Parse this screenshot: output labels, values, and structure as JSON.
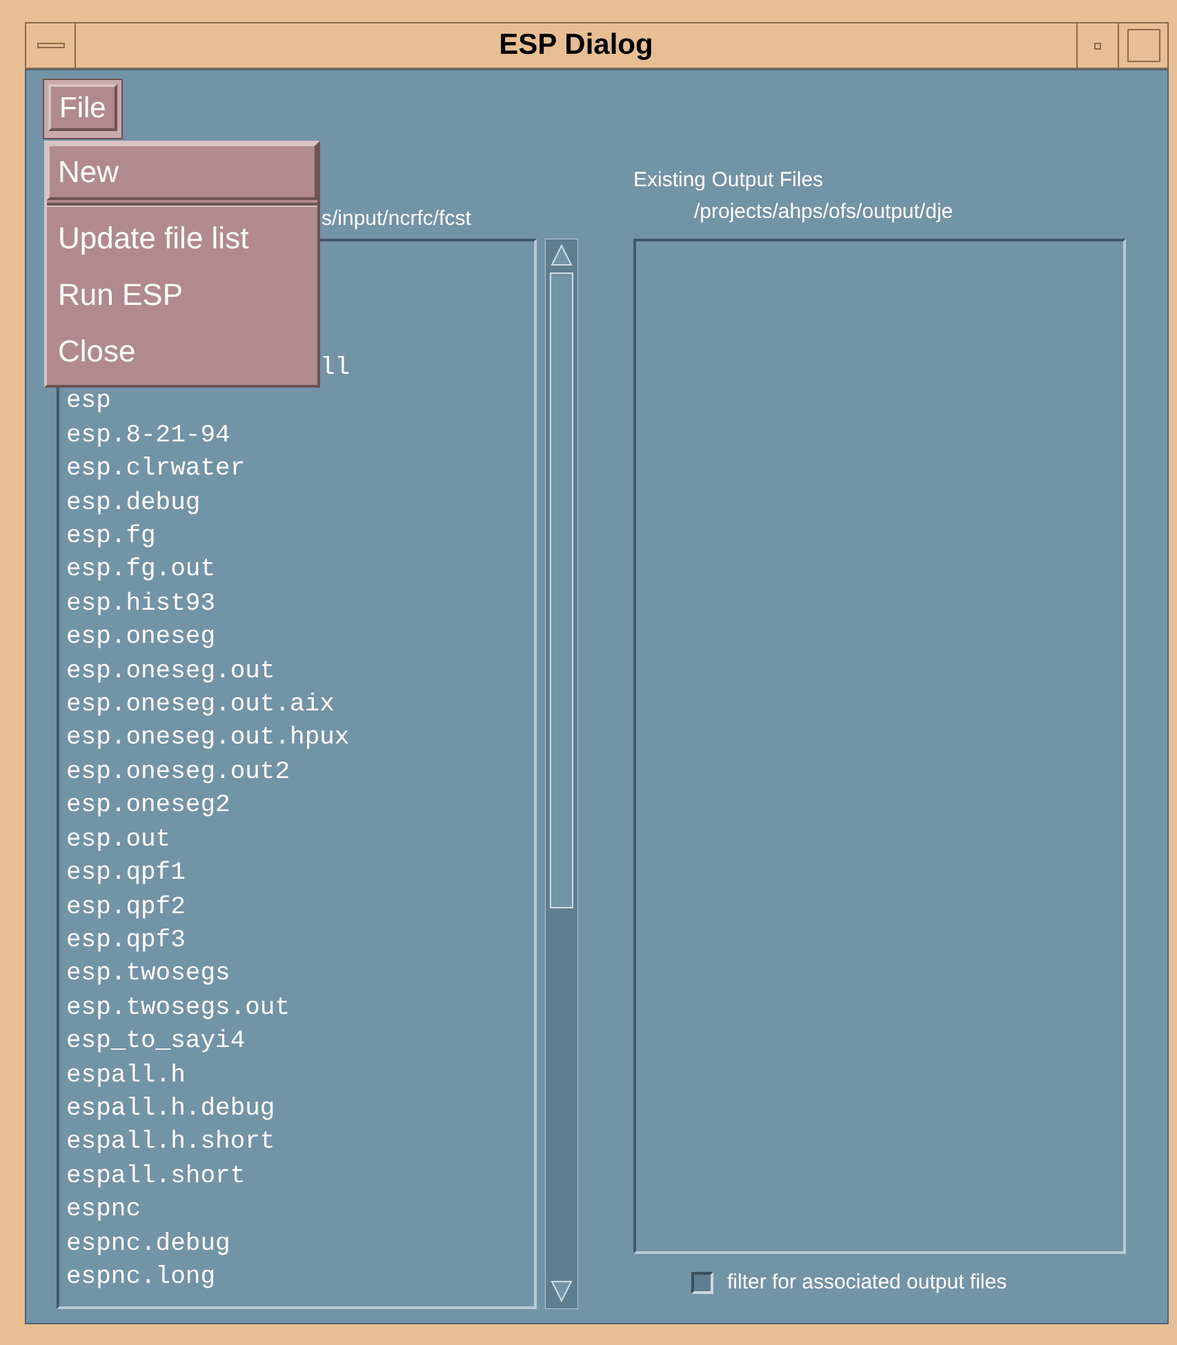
{
  "window": {
    "title": "ESP Dialog"
  },
  "menu_bar": [
    {
      "label": "File",
      "selected": true
    }
  ],
  "open_menu": {
    "items": [
      {
        "label": "New",
        "selected": true,
        "separator_after": true
      },
      {
        "label": "Update file list",
        "selected": false,
        "separator_after": false
      },
      {
        "label": "Run ESP",
        "selected": false,
        "separator_after": false
      },
      {
        "label": "Close",
        "selected": false,
        "separator_after": false
      }
    ]
  },
  "input_panel": {
    "path_fragment": "s/input/ncrfc/fcst",
    "obscured_item_fragment": "ll",
    "files": [
      "esp",
      "esp.8-21-94",
      "esp.clrwater",
      "esp.debug",
      "esp.fg",
      "esp.fg.out",
      "esp.hist93",
      "esp.oneseg",
      "esp.oneseg.out",
      "esp.oneseg.out.aix",
      "esp.oneseg.out.hpux",
      "esp.oneseg.out2",
      "esp.oneseg2",
      "esp.out",
      "esp.qpf1",
      "esp.qpf2",
      "esp.qpf3",
      "esp.twosegs",
      "esp.twosegs.out",
      "esp_to_sayi4",
      "espall.h",
      "espall.h.debug",
      "espall.h.short",
      "espall.short",
      "espnc",
      "espnc.debug",
      "espnc.long"
    ]
  },
  "output_panel": {
    "title": "Existing Output Files",
    "path": "/projects/ahps/ofs/output/dje"
  },
  "filter_checkbox": {
    "label": "filter for associated output files",
    "checked": false
  }
}
